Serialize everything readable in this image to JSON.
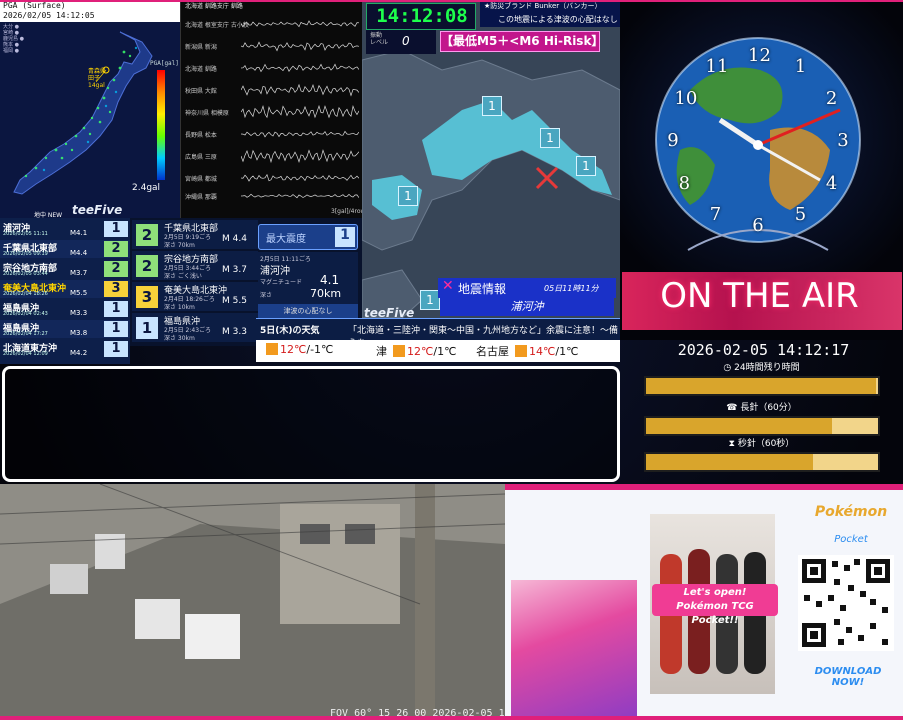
{
  "pga": {
    "header_line1": "PGA (Surface)",
    "header_line2": "2026/02/05 14:12:05",
    "scale_label": "PGA[gal]",
    "scale_ticks": [
      "100",
      "70",
      "50",
      "30",
      "10",
      "5",
      "3",
      "1",
      "0.5",
      "0.2",
      "0.1",
      "0.05",
      "0.01"
    ],
    "station_label_1": "青森県",
    "station_label_2": "田子",
    "station_label_3": "14gal",
    "value": "2.4gal",
    "logo": "teeFive",
    "brand_small": "地中 NEW"
  },
  "waveform": {
    "header": "北海道 釧路支庁 釧路",
    "stations": [
      "北海道 根室支庁 古小牧",
      "新潟県 新潟",
      "北海道 釧路",
      "秋田県 大館",
      "神奈川県 相模原",
      "長野県 松本",
      "広島県 三原",
      "宮崎県 都城",
      "沖縄県 那覇"
    ],
    "footer": "3[gal]/4row"
  },
  "intensity_list": [
    {
      "name": "浦河沖",
      "date": "2026/02/05 11:11",
      "mag": "M4.1",
      "int": "1",
      "name_color": "#ffffff",
      "int_bg": "#c8e4ff"
    },
    {
      "name": "千葉県北東部",
      "date": "2026/02/05 09:19",
      "mag": "M4.4",
      "int": "2",
      "name_color": "#ffffff",
      "int_bg": "#8fe07a"
    },
    {
      "name": "宗谷地方南部",
      "date": "2026/02/05 03:44",
      "mag": "M3.7",
      "int": "2",
      "name_color": "#ffffff",
      "int_bg": "#8fe07a"
    },
    {
      "name": "奄美大島北東沖",
      "date": "2026/02/04 18:26",
      "mag": "M5.5",
      "int": "3",
      "name_color": "#ffd400",
      "int_bg": "#f7d23a"
    },
    {
      "name": "福島県沖",
      "date": "2026/02/04 02:43",
      "mag": "M3.3",
      "int": "1",
      "name_color": "#ffffff",
      "int_bg": "#c8e4ff"
    },
    {
      "name": "福島県沖",
      "date": "2026/02/04 17:27",
      "mag": "M3.8",
      "int": "1",
      "name_color": "#ffffff",
      "int_bg": "#c8e4ff"
    },
    {
      "name": "北海道東方沖",
      "date": "2026/02/04 12:09",
      "mag": "M4.2",
      "int": "1",
      "name_color": "#ffffff",
      "int_bg": "#c8e4ff"
    }
  ],
  "detail_list": [
    {
      "name": "千葉県北東部",
      "info": "2月5日 9:19ごろ",
      "depth": "深さ 70km",
      "mag": "M 4.4",
      "int": "2",
      "int_bg": "#8fe07a"
    },
    {
      "name": "宗谷地方南部",
      "info": "2月5日 3:44ごろ",
      "depth": "深さ ごく浅い",
      "mag": "M 3.7",
      "int": "2",
      "int_bg": "#8fe07a"
    },
    {
      "name": "奄美大島北東沖",
      "info": "2月4日 18:26ごろ",
      "depth": "深さ 10km",
      "mag": "M 5.5",
      "int": "3",
      "int_bg": "#f7d23a"
    },
    {
      "name": "福島県沖",
      "info": "2月5日 2:43ごろ",
      "depth": "深さ 30km",
      "mag": "M 3.3",
      "int": "1",
      "int_bg": "#c8e4ff"
    }
  ],
  "latest": {
    "max_label": "最大震度",
    "max_value": "1",
    "time": "2月5日 11:11ごろ",
    "place": "浦河沖",
    "mag_label": "マグニチュード",
    "mag_value": "4.1",
    "depth_label": "深さ",
    "depth_value": "70km",
    "tsunami": "津波の心配なし"
  },
  "weather": {
    "date": "5日(木)の天気",
    "alert": "「北海道・三陸沖・関東～中国・九州地方など」余震に注意！～備えを～",
    "cities": [
      {
        "name": "",
        "hi": "12℃",
        "lo": "/-1℃"
      },
      {
        "name": "津",
        "hi": "12℃",
        "lo": "/1℃"
      },
      {
        "name": "名古屋",
        "hi": "14℃",
        "lo": "/1℃"
      }
    ]
  },
  "center": {
    "clock": "14:12:08",
    "bunker_title": "★防災ブランド Bunker（バンカー）",
    "bunker_sub": "この地震による津波の心配はなし",
    "seis_label_1": "振動",
    "seis_label_2": "レベル",
    "seis_value": "0",
    "risk": "【最低M5＋<M6 Hi-Risk】",
    "logo": "teeFive",
    "eq_title": "地震情報",
    "eq_time": "05日11時11分",
    "eq_place": "浦河沖",
    "markers": [
      "1",
      "1",
      "1",
      "1",
      "1"
    ]
  },
  "onair": {
    "text": "ON THE AIR",
    "datetime": "2026-02-05 14:12:17",
    "bars": [
      {
        "label": "24時間残り時間",
        "fill": 0.99,
        "icon": "clock-icon"
      },
      {
        "label": "長針（60分）",
        "fill": 0.8,
        "icon": "phone-icon"
      },
      {
        "label": "秒針（60秒）",
        "fill": 0.72,
        "icon": "hourglass-icon"
      }
    ],
    "clock_numbers": [
      "12",
      "1",
      "2",
      "3",
      "4",
      "5",
      "6",
      "7",
      "8",
      "9",
      "10",
      "11"
    ]
  },
  "camera": {
    "caption": "FOV 60°    15 26 00    2026-02-05 14:..."
  },
  "ad": {
    "brand": "Pokémon",
    "brand_sub": "Pocket",
    "banner_line1": "Let's open!",
    "banner_line2": "Pokémon TCG Pocket!!",
    "download": "DOWNLOAD NOW!"
  },
  "colors": {
    "accent_magenta": "#e0207a",
    "panel_navy": "#0c1d44",
    "clock_green": "#1dff4c"
  }
}
